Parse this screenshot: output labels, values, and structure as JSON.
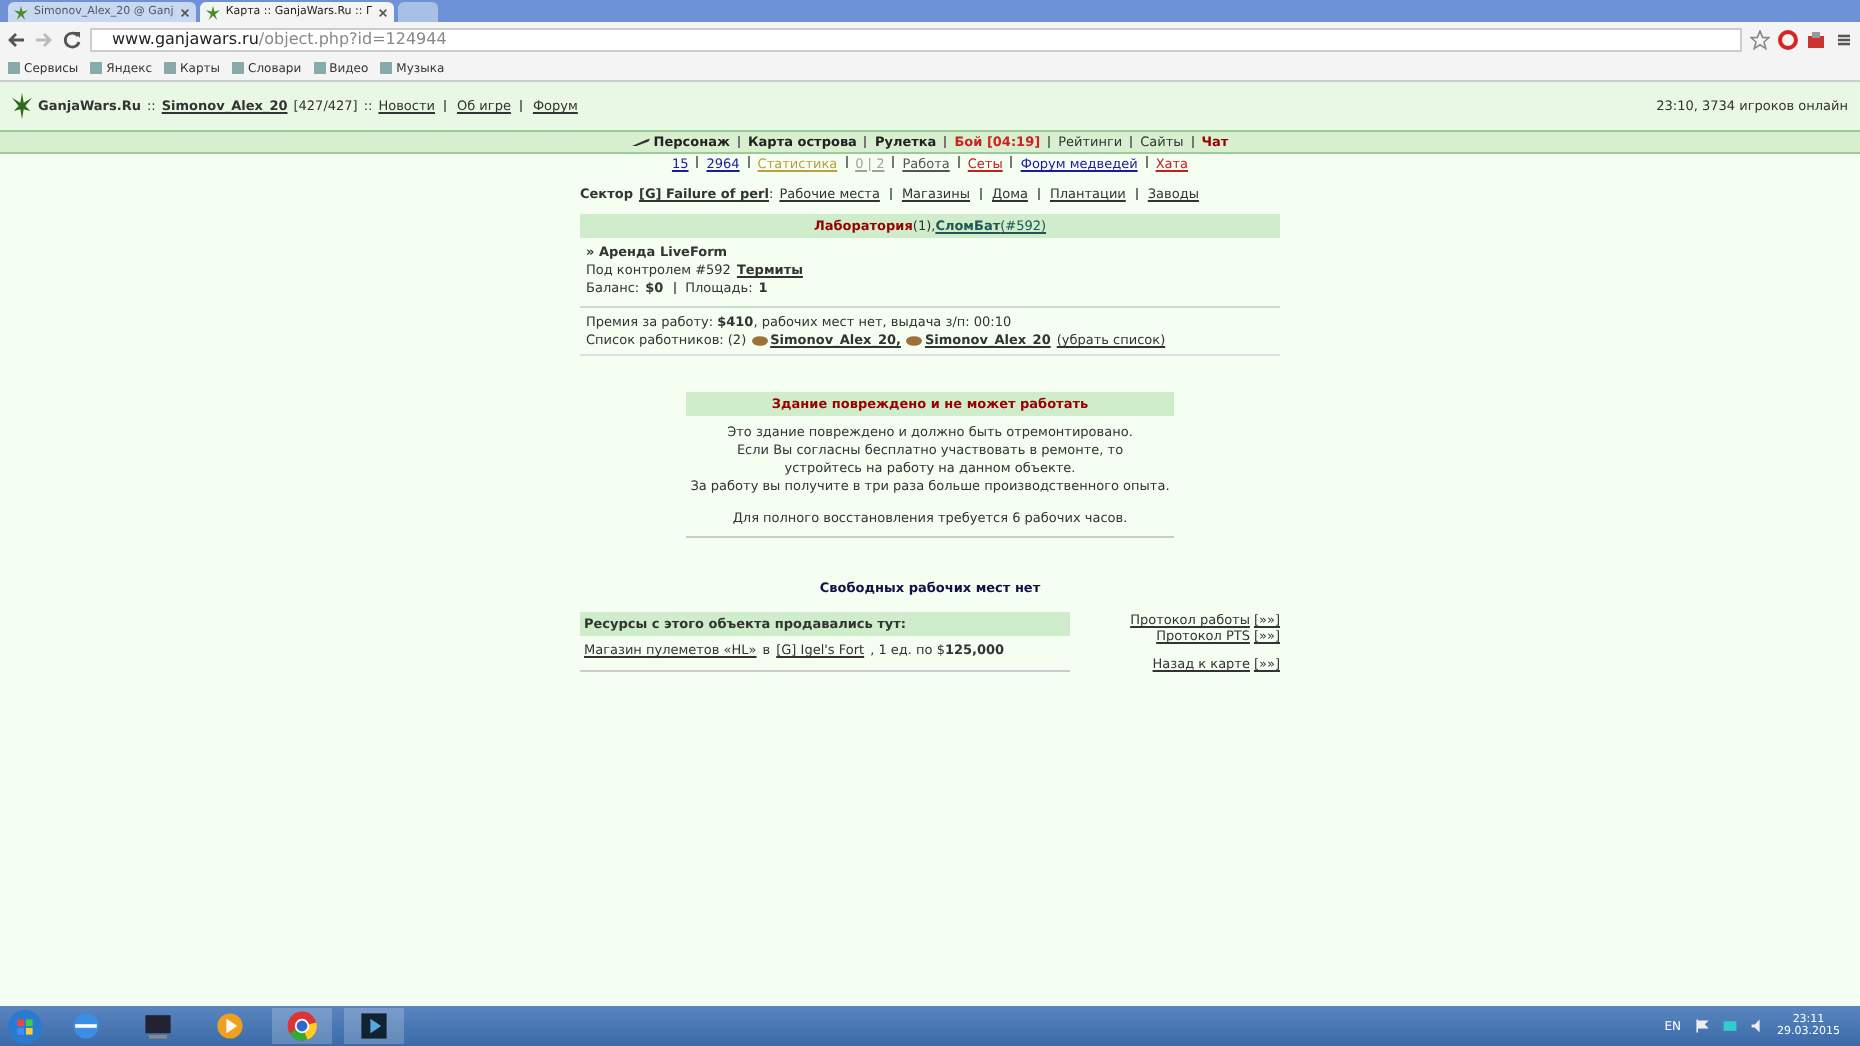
{
  "browser": {
    "tabs": [
      {
        "title": "Simonov_Alex_20 @ Ganj",
        "selected": false
      },
      {
        "title": "Карта :: GanjaWars.Ru :: Г",
        "selected": true
      }
    ],
    "address": {
      "host": "www.ganjawars.ru",
      "path": "/object.php?id=124944"
    },
    "bookmarks": [
      "Сервисы",
      "Яндекс",
      "Карты",
      "Словари",
      "Видео",
      "Музыка"
    ]
  },
  "header": {
    "site": "GanjaWars.Ru",
    "sep": "::",
    "user": "Simonov_Alex_20",
    "hp": "[427/427]",
    "sep2": "::",
    "links": [
      "Новости",
      "Об игре",
      "Форум"
    ],
    "online": "23:10, 3734 игроков онлайн"
  },
  "nav": [
    {
      "label": "Персонаж",
      "kind": "bold"
    },
    {
      "label": "Карта острова",
      "kind": "bold"
    },
    {
      "label": "Рулетка",
      "kind": "bold"
    },
    {
      "label": "Бой [04:19]",
      "kind": "alert"
    },
    {
      "label": "Рейтинги",
      "kind": "plain"
    },
    {
      "label": "Сайты",
      "kind": "plain"
    },
    {
      "label": "Чат",
      "kind": "chat"
    }
  ],
  "subnav": [
    {
      "label": "15",
      "color": "#1a1aa6"
    },
    {
      "label": "2964",
      "color": "#1a1aa6"
    },
    {
      "label": "Статистика",
      "color": "#b8a040"
    },
    {
      "label": "0 | 2",
      "color": "#a0a0a0"
    },
    {
      "label": "Работа",
      "color": "#555555"
    },
    {
      "label": "Сеты",
      "color": "#c02020"
    },
    {
      "label": "Форум медведей",
      "color": "#1a1aa6"
    },
    {
      "label": "Хата",
      "color": "#c02020"
    }
  ],
  "sector": {
    "label": "Сектор",
    "name": "[G] Failure of perl",
    "colon": ":",
    "links": [
      "Рабочие места",
      "Магазины",
      "Дома",
      "Плантации",
      "Заводы"
    ]
  },
  "object": {
    "type": "Лаборатория",
    "count": "(1),",
    "owner": "СломБат",
    "owner_id": "(#592)",
    "rent": "» Аренда LiveForm",
    "control_label": "Под контролем #592",
    "control": "Термиты",
    "balance_label": "Баланс:",
    "balance": "$0",
    "area_label": "Площадь:",
    "area": "1",
    "pay": "Премия за работу: **$410**, рабочих мест нет, выдача з/п: 00:10",
    "workers_label": "Список работников: (2)",
    "workers": [
      "Simonov_Alex_20,",
      "Simonov_Alex_20"
    ],
    "workers_link": "(убрать список)"
  },
  "damage": {
    "title": "Здание повреждено и не может работать",
    "lines": [
      "Это здание повреждено и должно быть отремонтировано.",
      "Если Вы согласны бесплатно участвовать в ремонте, то",
      "устройтесь на работу на данном объекте.",
      "За работу вы получите в три раза больше производственного опыта."
    ],
    "note": "Для полного восстановления требуется 6 рабочих часов."
  },
  "free_places": "Свободных рабочих мест нет",
  "resources": {
    "title": "Ресурсы с этого объекта продавались тут:",
    "shop": "Магазин пулеметов «HL»",
    "in": "в",
    "place": "[G] Igel's Fort",
    "price": ", 1 ед. по $**125,000**"
  },
  "side_links": [
    {
      "label": "Протокол работы",
      "more": "[»»]"
    },
    {
      "label": "Протокол PTS",
      "more": "[»»]"
    },
    {
      "label": "Назад к карте",
      "more": "[»»]"
    }
  ],
  "taskbar": {
    "lang": "EN",
    "time": "23:11",
    "date": "29.03.2015"
  }
}
